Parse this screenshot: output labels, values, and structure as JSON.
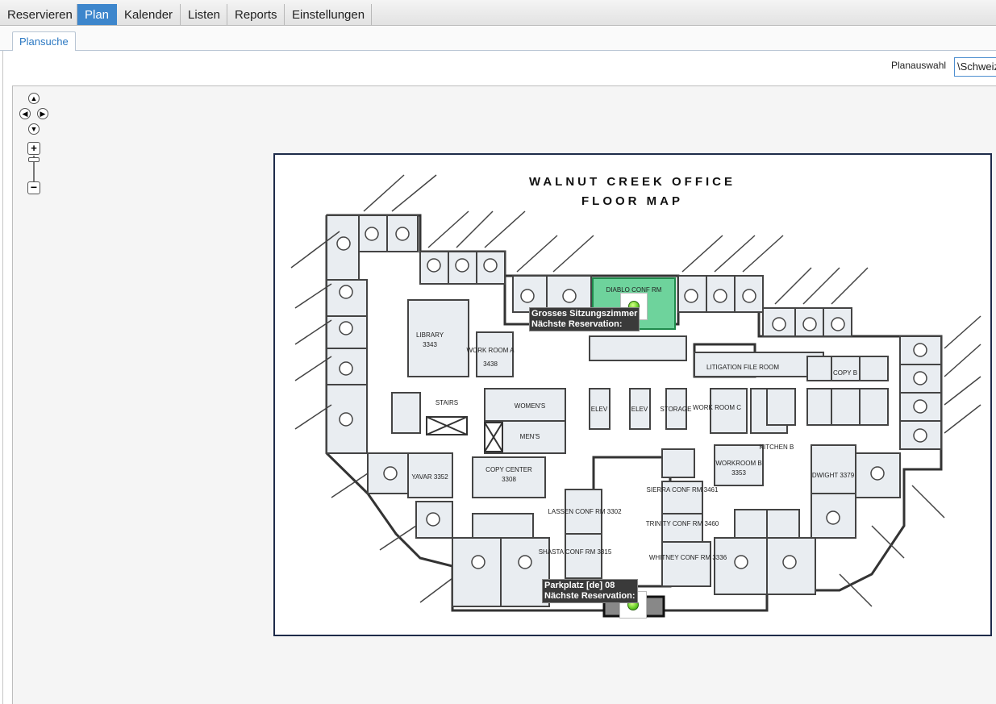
{
  "nav": {
    "items": [
      {
        "label": "Reservieren"
      },
      {
        "label": "Plan",
        "active": true
      },
      {
        "label": "Kalender"
      },
      {
        "label": "Listen"
      },
      {
        "label": "Reports"
      },
      {
        "label": "Einstellungen"
      }
    ]
  },
  "subtab": {
    "label": "Plansuche"
  },
  "plan_select": {
    "label": "Planauswahl",
    "value": "\\Schweiz"
  },
  "map": {
    "title_line1": "WALNUT CREEK OFFICE",
    "title_line2": "FLOOR MAP",
    "rooms": {
      "library": "LIBRARY",
      "library_num": "3343",
      "work_room_a": "WORK ROOM A",
      "work_room_a_num": "3438",
      "litigation": "LITIGATION FILE ROOM",
      "womens": "WOMEN'S",
      "mens": "MEN'S",
      "copy_center": "COPY CENTER",
      "copy_center_num": "3308",
      "workroom_b": "WORKROOM B",
      "workroom_b_num": "3353",
      "stairs": "STAIRS",
      "elev1": "ELEV",
      "elev2": "ELEV",
      "storage": "STORAGE",
      "work_room_c": "WORK ROOM C",
      "sierra": "SIERRA CONF RM 3461",
      "trinity": "TRINITY CONF RM 3460",
      "whitney": "WHITNEY CONF RM 3336",
      "shasta": "SHASTA CONF RM 3315",
      "lassen": "LASSEN CONF RM 3302",
      "diablo": "DIABLO CONF RM",
      "dwight": "DWIGHT 3379",
      "copy_b": "COPY B",
      "yavar": "YAVAR 3352",
      "kitchen_b": "KITCHEN B"
    }
  },
  "markers": {
    "room1": {
      "name": "Grosses Sitzungszimmer",
      "next": "Nächste Reservation:"
    },
    "room2": {
      "name": "Parkplatz [de] 08",
      "next": "Nächste Reservation:"
    }
  },
  "colors": {
    "nav_active": "#3d86cc",
    "highlight_room": "#6ed39c",
    "marker": "#6bd12a"
  },
  "icons": {
    "pan": "pan-arrows-icon",
    "zoom_in": "plus-icon",
    "zoom_out": "minus-icon"
  }
}
